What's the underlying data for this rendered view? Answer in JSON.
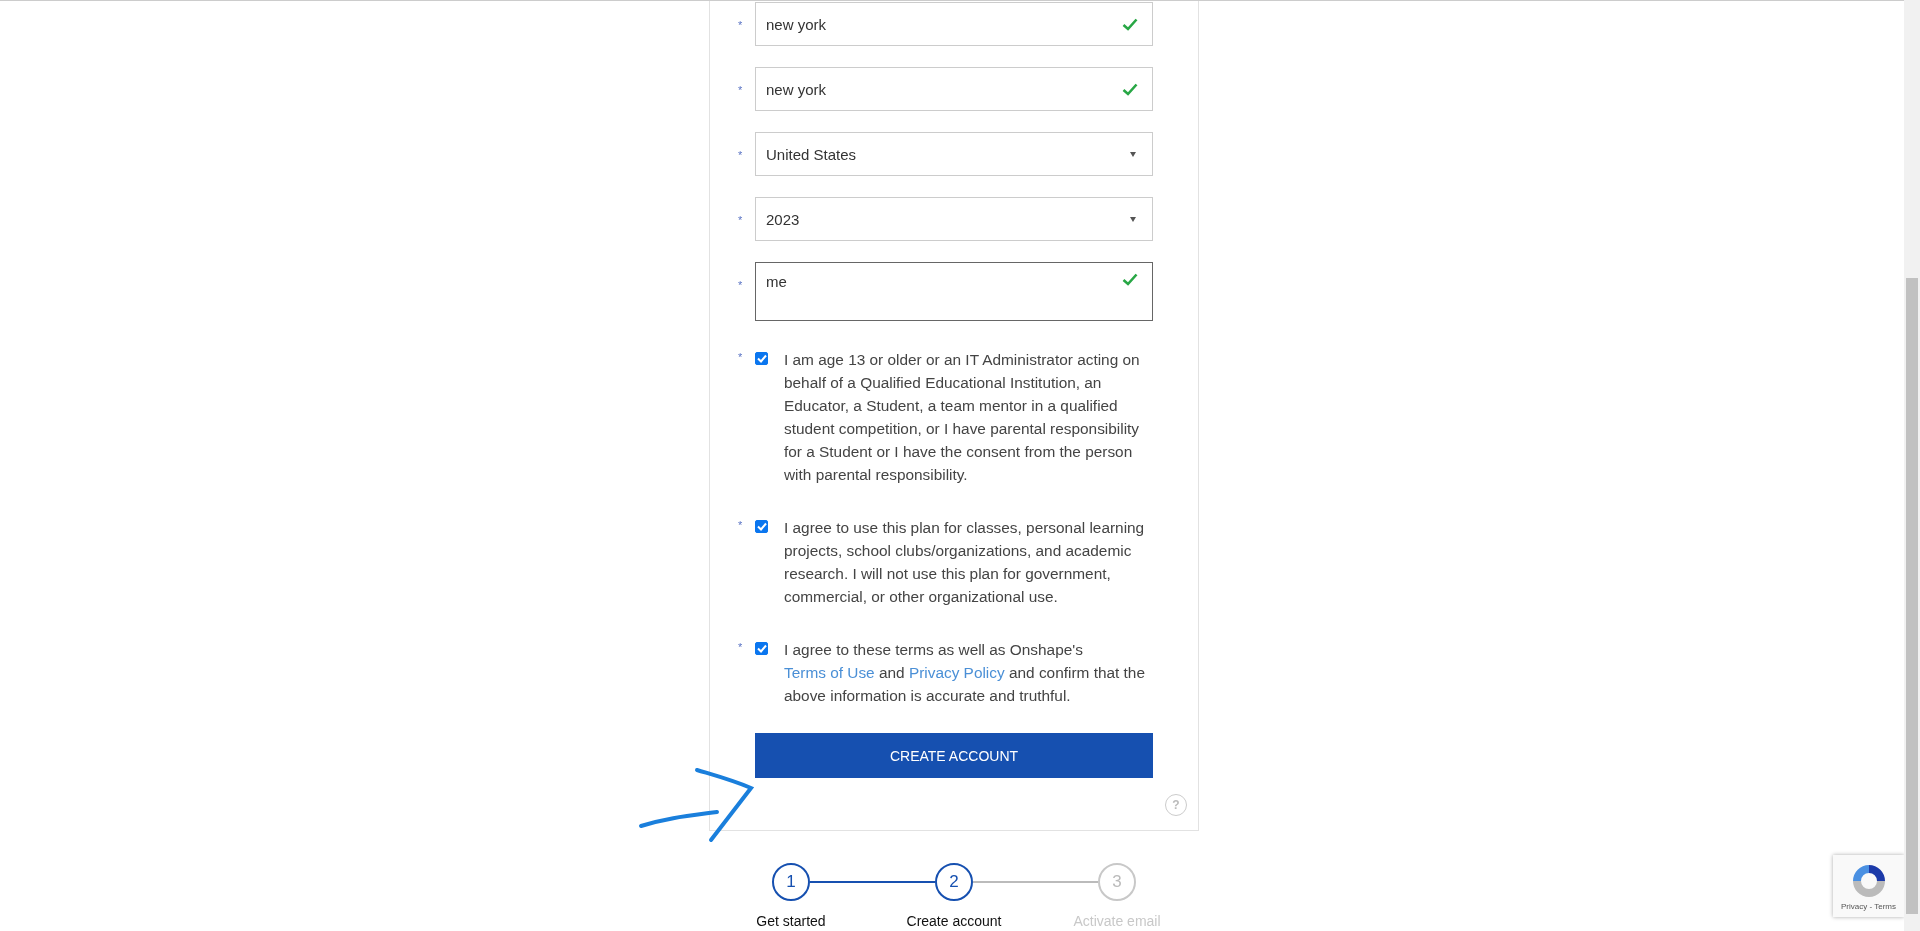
{
  "fields": [
    {
      "kind": "text",
      "marker": "*",
      "value": "new york",
      "valid": true,
      "focused": false
    },
    {
      "kind": "text",
      "marker": "*",
      "value": "new york",
      "valid": true,
      "focused": false
    },
    {
      "kind": "select",
      "marker": "*",
      "value": "United States",
      "focused": false
    },
    {
      "kind": "select",
      "marker": "*",
      "value": "2023",
      "focused": false
    },
    {
      "kind": "textarea",
      "marker": "*",
      "value": "me",
      "valid": true,
      "focused": true
    }
  ],
  "agreements": [
    {
      "marker": "*",
      "checked": true,
      "parts": [
        {
          "kind": "text",
          "text": "I am age 13 or older or an IT Administrator acting on behalf of a Qualified Educational Institution, an Educator, a Student, a team mentor in a qualified student competition, or I have parental responsibility for a Student or I have the consent from the person with parental responsibility."
        }
      ]
    },
    {
      "marker": "*",
      "checked": true,
      "parts": [
        {
          "kind": "text",
          "text": "I agree to use this plan for classes, personal learning projects, school clubs/organizations, and academic research. I will not use this plan for government, commercial, or other organizational use."
        }
      ]
    },
    {
      "marker": "*",
      "checked": true,
      "parts": [
        {
          "kind": "text",
          "text": "I agree to these terms as well as Onshape's "
        },
        {
          "kind": "link",
          "text": "Terms of Use"
        },
        {
          "kind": "text",
          "text": " and "
        },
        {
          "kind": "link",
          "text": "Privacy Policy"
        },
        {
          "kind": "text",
          "text": " and confirm that the above information is accurate and truthful."
        }
      ]
    }
  ],
  "submit": "CREATE ACCOUNT",
  "help": "?",
  "steps": [
    {
      "number": "1",
      "label": "Get started",
      "reached": true
    },
    {
      "number": "2",
      "label": "Create account",
      "reached": true
    },
    {
      "number": "3",
      "label": "Activate email",
      "reached": false
    }
  ],
  "recaptcha": {
    "links": "Privacy - Terms"
  }
}
